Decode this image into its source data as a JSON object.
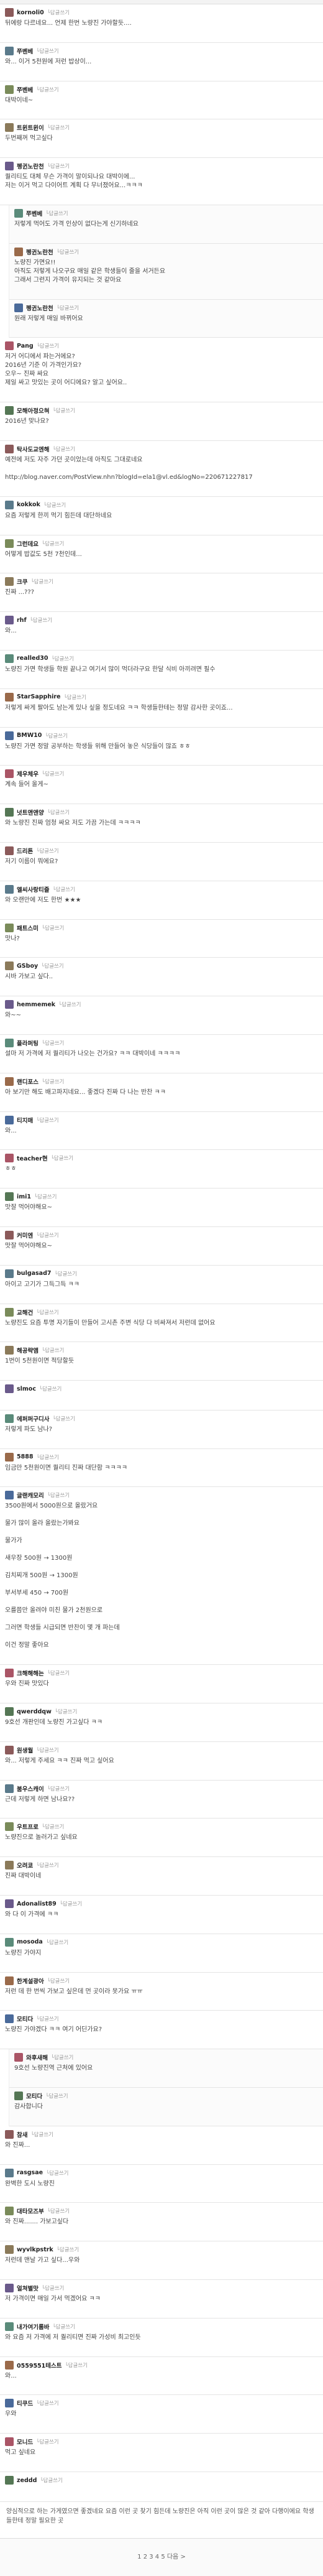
{
  "reply_label": "└답글쓰기",
  "comments": [
    {
      "nick": "kornoli0",
      "text": "뒤에랑 다르네요... 언제 한번 노량진 가야할듯....",
      "reply": false
    },
    {
      "nick": "쭈벤베",
      "text": "와... 이거 5천원에 저런 밥상이...",
      "reply": false
    },
    {
      "nick": "쭈벤베",
      "text": "대박이네~",
      "reply": false
    },
    {
      "nick": "트윈트윈이",
      "text": "두번째꺼 먹고싶다",
      "reply": false
    },
    {
      "nick": "펭귄노란천",
      "text": "퀄리티도 대체 무슨 가격이 말이되나요 대박이에...\n저는 이거 먹고 다이어트 계획 다 무너졌어요...ㅋㅋㅋ",
      "reply": false
    },
    {
      "nick": "쭈벤베",
      "text": "저렇게 먹어도 가격 인상이 없다는게 신기하네요",
      "reply": true
    },
    {
      "nick": "펭귄노란천",
      "text": "노량진 가면요!!\n아직도 저렇게 나오구요 매일 같은 학생들이 줄을 서거든요\n그래서 그런지 가격이 유지되는 것 같아요",
      "reply": true
    },
    {
      "nick": "펭귄노란천",
      "text": "원래 저렇게 매일 바뀌어요",
      "reply": true
    },
    {
      "nick": "Pang",
      "text": "저거 어디에서 파는거에요?\n2016년 기준 이 가격인가요?\n오우~ 진짜 싸요\n제일 싸고 맛있는 곳이 어디에요? 알고 싶어요..",
      "reply": false
    },
    {
      "nick": "모해아정으혀",
      "text": "2016년 맞나요?",
      "reply": false
    },
    {
      "nick": "탁사도교엔해",
      "text": "예전에 저도 자주 가던 곳이었는데 아직도 그대로네요\n\nhttp://blog.naver.com/PostView.nhn?blogId=ela1@vl.ed&logNo=220671227817",
      "reply": false
    },
    {
      "nick": "kokkok",
      "text": "요즘 저렇게 한끼 먹기 힘든데 대단하네요",
      "reply": false
    },
    {
      "nick": "그런데요",
      "text": "어떻게 밥값도 5천 7천인데...",
      "reply": false
    },
    {
      "nick": "크쿠",
      "text": "진짜 ...???",
      "reply": false
    },
    {
      "nick": "rhf",
      "text": "와...",
      "reply": false
    },
    {
      "nick": "realled30",
      "text": "노량진 가면 학생들 학원 끝나고 여기서 많이 먹더라구요 한달 식비 아끼려면 필수",
      "reply": false
    },
    {
      "nick": "StarSapphire",
      "text": "저렇게 싸게 팔아도 남는게 있나 싶을 정도네요 ㅋㅋ 학생들한테는 정말 감사한 곳이죠...",
      "reply": false
    },
    {
      "nick": "BMW10",
      "text": "노량진 가면 정말 공부하는 학생들 위해 만들어 놓은 식당들이 많죠 ㅎㅎ",
      "reply": false
    },
    {
      "nick": "제우체우",
      "text": "계속 들어 올게~",
      "reply": false
    },
    {
      "nick": "넛트앤앤양",
      "text": "와 노량진 진짜 엄청 싸요 저도 가끔 가는데 ㅋㅋㅋㅋ",
      "reply": false
    },
    {
      "nick": "드리튼",
      "text": "저기 이름이 뭐에요?",
      "reply": false
    },
    {
      "nick": "엘씨사랑티즐",
      "text": "와 오랜만에 저도 한번 ★★★",
      "reply": false
    },
    {
      "nick": "패트스미",
      "text": "맛나?",
      "reply": false
    },
    {
      "nick": "GSboy",
      "text": "시바 가보고 싶다..",
      "reply": false
    },
    {
      "nick": "hemmemek",
      "text": "와~~",
      "reply": false
    },
    {
      "nick": "플라퍼팅",
      "text": "설마 저 가격에 저 퀄리티가 나오는 건가요? ㅋㅋ 대박이네 ㅋㅋㅋㅋ",
      "reply": false
    },
    {
      "nick": "랜디포스",
      "text": "아 보기만 해도 배고파지네요... 좋겠다 진짜 다 나는 반찬 ㅋㅋ",
      "reply": false
    },
    {
      "nick": "티지매",
      "text": "와...",
      "reply": false
    },
    {
      "nick": "teacher현",
      "text": "ㅎㅎ",
      "reply": false
    },
    {
      "nick": "imi1",
      "text": "맛잘 먹어야해요~",
      "reply": false
    },
    {
      "nick": "커미엔",
      "text": "맛잘 먹어야해요~",
      "reply": false
    },
    {
      "nick": "bulgasad7",
      "text": "아이고 고기가 그득그득 ㅋㅋ",
      "reply": false
    },
    {
      "nick": "교해건",
      "text": "노량진도 요즘 투명 자기들이 만들어 고시촌 주변 식당 다 비싸져서 저런데 없어요",
      "reply": false
    },
    {
      "nick": "해공략앰",
      "text": "1번이 5천원이면 적당할듯",
      "reply": false
    },
    {
      "nick": "slmoc",
      "text": "",
      "reply": false
    },
    {
      "nick": "에퍼퍼구디사",
      "text": "저렇게 파도 남나?",
      "reply": false
    },
    {
      "nick": "5888",
      "text": "임금만 5천원이면 퀄리티 진짜 대단함 ㅋㅋㅋㅋ",
      "reply": false
    },
    {
      "nick": "글랜캐모리",
      "text": "3500원에서 5000원으로 올랐거요\n\n물가 많이 올라 올랐는가봐요\n\n물가가\n\n새우장 500원 → 1300원\n\n김치찌개 500원 → 1300원\n\n부서부세 450 → 700원\n\n오를쯤만 올려야 미친 물가 2천원으로\n\n그러면 학생들 시급되면 반찬이 몇 개 파는데\n\n이건 정말 좋아요",
      "reply": false
    },
    {
      "nick": "크해해해는",
      "text": "우와 진짜 맛있다",
      "reply": false
    },
    {
      "nick": "qwerddqw",
      "text": "9호선 개판인데 노량진 가고싶다 ㅋㅋ",
      "reply": false
    },
    {
      "nick": "원생월",
      "text": "와... 저렇게 주세요 ㅋㅋ 진짜 먹고 싶어요",
      "reply": false
    },
    {
      "nick": "붐우스캐이",
      "text": "근데 저렇게 하면 남나요??",
      "reply": false
    },
    {
      "nick": "우트프로",
      "text": "노량진으로 놀러가고 싶네요",
      "reply": false
    },
    {
      "nick": "오려쿄",
      "text": "진짜 대박이네",
      "reply": false
    },
    {
      "nick": "Adonalist89",
      "text": "와 다 이 가격에 ㅋㅋ",
      "reply": false
    },
    {
      "nick": "mosoda",
      "text": "노량진 가야지",
      "reply": false
    },
    {
      "nick": "한계설광아",
      "text": "저런 데 한 번씩 가보고 싶은데 먼 곳이라 못가요 ㅠㅠ",
      "reply": false
    },
    {
      "nick": "모티다",
      "text": "노량진 가야겠다 ㅋㅋ 여기 어딘가요?",
      "reply": false
    },
    {
      "nick": "와후새해",
      "text": "9호선 노량진역 근처에 있어요",
      "reply": true
    },
    {
      "nick": "모티다",
      "text": "감사합니다",
      "reply": true
    },
    {
      "nick": "참새",
      "text": "와 진짜...",
      "reply": false
    },
    {
      "nick": "rasgsae",
      "text": "완벽한 도시 노량진",
      "reply": false
    },
    {
      "nick": "대타모즈부",
      "text": "와 진짜....... 가보고싶다",
      "reply": false
    },
    {
      "nick": "wyvlkpstrk",
      "text": "저런데 맨날 가고 싶다...우와",
      "reply": false
    },
    {
      "nick": "얼쳐별맛",
      "text": "저 가격이면 매일 가서 먹겠어요 ㅋㅋ",
      "reply": false
    },
    {
      "nick": "내가여기롬바",
      "text": "와 요즘 저 가격에 저 퀄리티면 진짜 가성비 최고인듯",
      "reply": false
    },
    {
      "nick": "0559551테스트",
      "text": "와...",
      "reply": false
    },
    {
      "nick": "티쿠드",
      "text": "우와",
      "reply": false
    },
    {
      "nick": "모니드",
      "text": "먹고 싶네요",
      "reply": false
    },
    {
      "nick": "zeddd",
      "text": "",
      "reply": false
    }
  ],
  "footer": "양심적으로 하는 가게였으면 좋겠네요 요즘 이런 곳 찾기 힘든데 노량진은 아직 이런 곳이 많은 것 같아 다행이에요 학생들한테 정말 필요한 곳",
  "pager": "1  2  3  4  5  다음 >"
}
